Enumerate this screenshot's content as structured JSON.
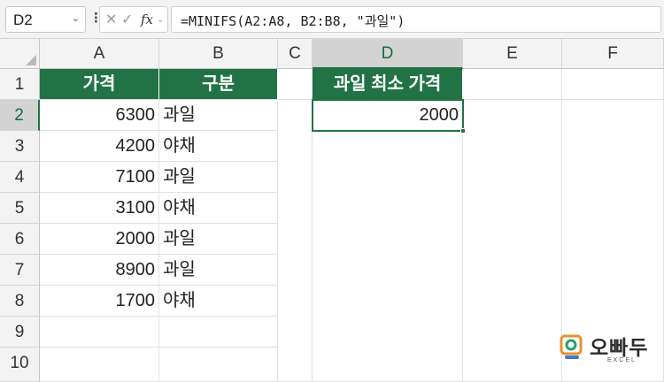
{
  "name_box": {
    "value": "D2"
  },
  "formula_bar": {
    "cancel_icon": "close-icon",
    "enter_icon": "check-icon",
    "fx_label": "fx",
    "formula": "=MINIFS(A2:A8, B2:B8, \"과일\")"
  },
  "columns": [
    "A",
    "B",
    "C",
    "D",
    "E",
    "F"
  ],
  "rows": [
    "1",
    "2",
    "3",
    "4",
    "5",
    "6",
    "7",
    "8",
    "9",
    "10"
  ],
  "selected_cell": "D2",
  "sheet": {
    "header_price": "가격",
    "header_category": "구분",
    "header_result": "과일 최소 가격",
    "data": [
      {
        "price": "6300",
        "category": "과일"
      },
      {
        "price": "4200",
        "category": "야채"
      },
      {
        "price": "7100",
        "category": "과일"
      },
      {
        "price": "3100",
        "category": "야채"
      },
      {
        "price": "2000",
        "category": "과일"
      },
      {
        "price": "8900",
        "category": "과일"
      },
      {
        "price": "1700",
        "category": "야채"
      }
    ],
    "result": "2000"
  },
  "colors": {
    "header_fill": "#217346",
    "header_text": "#ffffff",
    "selection": "#217346"
  },
  "logo": {
    "text": "오빠두",
    "sub": "EXCEL"
  }
}
